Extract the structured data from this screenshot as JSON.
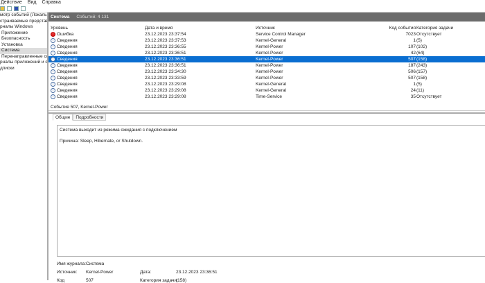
{
  "menu": [
    "Действие",
    "Вид",
    "Справка"
  ],
  "tree": [
    {
      "label": "мотр событий (Локальный)",
      "sub": false
    },
    {
      "label": "страиваемые представления",
      "sub": false
    },
    {
      "label": "рналы Windows",
      "sub": false
    },
    {
      "label": "Приложение",
      "sub": true
    },
    {
      "label": "Безопасность",
      "sub": true
    },
    {
      "label": "Установка",
      "sub": true
    },
    {
      "label": "Система",
      "sub": true,
      "selected": true
    },
    {
      "label": "Перенаправленные события",
      "sub": true
    },
    {
      "label": "рналы приложений и служб",
      "sub": false
    },
    {
      "label": "дписки",
      "sub": false
    }
  ],
  "header": {
    "title": "Система",
    "count": "Событий: 4 131"
  },
  "columns": [
    "Уровень",
    "Дата и время",
    "Источник",
    "Код события",
    "Категория задачи"
  ],
  "rows": [
    [
      "Ошибка",
      "23.12.2023 23:37:54",
      "Service Control Manager",
      "7023",
      "Отсутствует"
    ],
    [
      "Сведения",
      "23.12.2023 23:37:53",
      "Kernel-General",
      "1",
      "(5)"
    ],
    [
      "Сведения",
      "23.12.2023 23:36:55",
      "Kernel-Power",
      "107",
      "(102)"
    ],
    [
      "Сведения",
      "23.12.2023 23:36:51",
      "Kernel-Power",
      "42",
      "(64)"
    ],
    [
      "Сведения",
      "23.12.2023 23:36:51",
      "Kernel-Power",
      "507",
      "(158)"
    ],
    [
      "Сведения",
      "23.12.2023 23:36:51",
      "Kernel-Power",
      "187",
      "(243)"
    ],
    [
      "Сведения",
      "23.12.2023 23:34:30",
      "Kernel-Power",
      "506",
      "(157)"
    ],
    [
      "Сведения",
      "23.12.2023 23:33:59",
      "Kernel-Power",
      "507",
      "(158)"
    ],
    [
      "Сведения",
      "23.12.2023 23:29:08",
      "Kernel-General",
      "1",
      "(5)"
    ],
    [
      "Сведения",
      "23.12.2023 23:29:08",
      "Kernel-General",
      "24",
      "(11)"
    ],
    [
      "Сведения",
      "23.12.2023 23:29:08",
      "Time-Service",
      "35",
      "Отсутствует"
    ]
  ],
  "selected_row": 4,
  "detail": {
    "title": "Событие 507, Kernel-Power",
    "tabs": [
      "Общие",
      "Подробности"
    ],
    "message": "Система выходит из режима ожидания с подключением",
    "reason": "Причина: Sleep, Hibernate, or Shutdown.",
    "log_label": "Имя журнала:",
    "log_value": "Система",
    "source_label": "Источник:",
    "source_value": "Kernel-Power",
    "date_label": "Дата:",
    "date_value": "23.12.2023 23:36:51",
    "code_label": "Код",
    "code_value": "507",
    "cat_label": "Категория задачи:",
    "cat_value": "(158)"
  }
}
